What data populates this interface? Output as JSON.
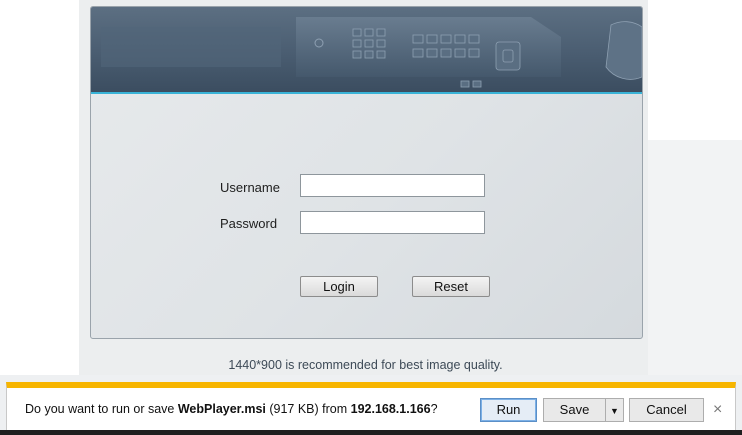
{
  "login": {
    "username_label": "Username",
    "password_label": "Password",
    "username_value": "",
    "password_value": "",
    "login_button": "Login",
    "reset_button": "Reset"
  },
  "recommendation": "1440*900 is recommended for best image quality.",
  "download_bar": {
    "message_prefix": "Do you want to run or save ",
    "file_name": "WebPlayer.msi",
    "file_size": " (917 KB) from ",
    "source": "192.168.1.166",
    "message_suffix": "?",
    "run_button": "Run",
    "save_button": "Save",
    "save_dropdown": "▼",
    "cancel_button": "Cancel",
    "close_symbol": "×"
  },
  "colors": {
    "banner_top": "#5c6f82",
    "banner_bottom": "#3b4d60",
    "banner_accent": "#39b3d7",
    "notification_accent": "#f7b500"
  },
  "icons": {
    "dropdown": "chevron-down-icon",
    "close": "close-icon"
  }
}
